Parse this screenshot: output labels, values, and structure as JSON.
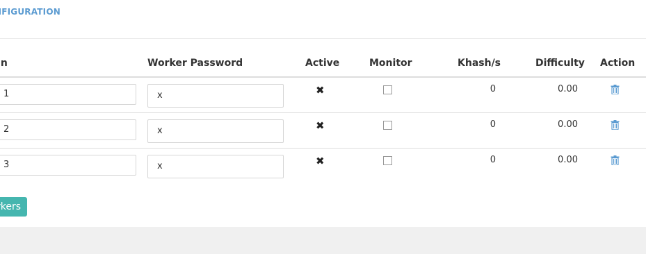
{
  "section": {
    "title": "NFIGURATION"
  },
  "table": {
    "headers": {
      "login": "gin",
      "password": "Worker Password",
      "active": "Active",
      "monitor": "Monitor",
      "khash": "Khash/s",
      "difficulty": "Difficulty",
      "action": "Action"
    },
    "rows": [
      {
        "login": "1",
        "password": "x",
        "active_icon": "times-icon",
        "monitor_checked": false,
        "khash": "0",
        "difficulty": "0.00"
      },
      {
        "login": "2",
        "password": "x",
        "active_icon": "times-icon",
        "monitor_checked": false,
        "khash": "0",
        "difficulty": "0.00"
      },
      {
        "login": "3",
        "password": "x",
        "active_icon": "times-icon",
        "monitor_checked": false,
        "khash": "0",
        "difficulty": "0.00"
      }
    ],
    "action_icon": "trash-icon"
  },
  "actions": {
    "add_label": "rkers"
  },
  "colors": {
    "title": "#5b9bd1",
    "button": "#45b6af",
    "trash": "#5b9bd1",
    "footer": "#f0f0f0"
  }
}
